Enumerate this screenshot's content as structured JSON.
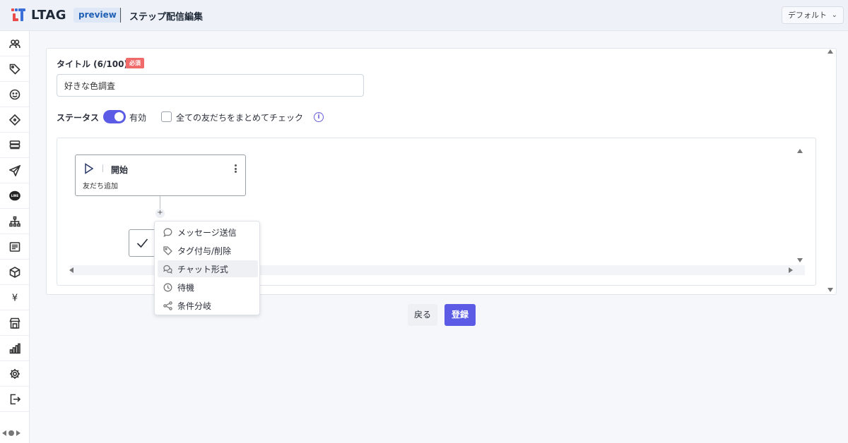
{
  "header": {
    "brand": "LTAG",
    "badge": "preview",
    "page_title": "ステップ配信編集",
    "view_select": "デフォルト",
    "view_select_chevron": "⌄"
  },
  "sidebar": {
    "items": [
      {
        "icon": "users-icon"
      },
      {
        "icon": "tag-icon"
      },
      {
        "icon": "smile-icon"
      },
      {
        "icon": "ticket-icon"
      },
      {
        "icon": "database-icon"
      },
      {
        "icon": "send-icon"
      },
      {
        "icon": "line-icon",
        "label": "LINE"
      },
      {
        "icon": "sitemap-icon"
      },
      {
        "icon": "list-icon"
      },
      {
        "icon": "package-icon"
      },
      {
        "icon": "yen-icon",
        "label": "¥"
      },
      {
        "icon": "store-icon"
      },
      {
        "icon": "bar-chart-icon"
      },
      {
        "icon": "gear-icon"
      },
      {
        "icon": "logout-icon"
      }
    ]
  },
  "form": {
    "title_label": "タイトル (6/100)",
    "required_badge": "必須",
    "title_value": "好きな色調査",
    "status_label": "ステータス",
    "status_on": true,
    "status_text": "有効",
    "check_all_label": "全ての友だちをまとめてチェック",
    "check_all_checked": false,
    "info_glyph": "i"
  },
  "flow": {
    "start_node": {
      "title": "開始",
      "subtitle": "友だち追加"
    },
    "add_glyph": "+",
    "menu": [
      {
        "label": "メッセージ送信",
        "icon": "chat-bubble-icon",
        "active": false
      },
      {
        "label": "タグ付与/削除",
        "icon": "tag-icon",
        "active": false
      },
      {
        "label": "チャット形式",
        "icon": "chat-dialog-icon",
        "active": true
      },
      {
        "label": "待機",
        "icon": "clock-icon",
        "active": false
      },
      {
        "label": "条件分岐",
        "icon": "branch-icon",
        "active": false
      }
    ]
  },
  "actions": {
    "back_label": "戻る",
    "submit_label": "登録"
  },
  "colors": {
    "accent": "#5b5be6",
    "required": "#f16a6a",
    "badge_bg": "#dde7f6",
    "badge_text": "#1f5fb5"
  }
}
